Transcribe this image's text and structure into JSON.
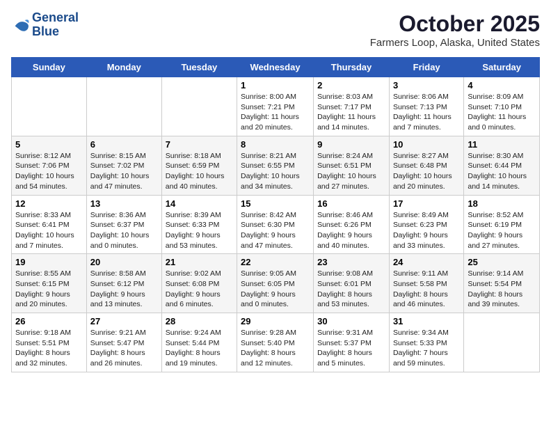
{
  "header": {
    "logo_line1": "General",
    "logo_line2": "Blue",
    "title": "October 2025",
    "subtitle": "Farmers Loop, Alaska, United States"
  },
  "days_of_week": [
    "Sunday",
    "Monday",
    "Tuesday",
    "Wednesday",
    "Thursday",
    "Friday",
    "Saturday"
  ],
  "weeks": [
    [
      {
        "date": "",
        "info": ""
      },
      {
        "date": "",
        "info": ""
      },
      {
        "date": "",
        "info": ""
      },
      {
        "date": "1",
        "info": "Sunrise: 8:00 AM\nSunset: 7:21 PM\nDaylight: 11 hours\nand 20 minutes."
      },
      {
        "date": "2",
        "info": "Sunrise: 8:03 AM\nSunset: 7:17 PM\nDaylight: 11 hours\nand 14 minutes."
      },
      {
        "date": "3",
        "info": "Sunrise: 8:06 AM\nSunset: 7:13 PM\nDaylight: 11 hours\nand 7 minutes."
      },
      {
        "date": "4",
        "info": "Sunrise: 8:09 AM\nSunset: 7:10 PM\nDaylight: 11 hours\nand 0 minutes."
      }
    ],
    [
      {
        "date": "5",
        "info": "Sunrise: 8:12 AM\nSunset: 7:06 PM\nDaylight: 10 hours\nand 54 minutes."
      },
      {
        "date": "6",
        "info": "Sunrise: 8:15 AM\nSunset: 7:02 PM\nDaylight: 10 hours\nand 47 minutes."
      },
      {
        "date": "7",
        "info": "Sunrise: 8:18 AM\nSunset: 6:59 PM\nDaylight: 10 hours\nand 40 minutes."
      },
      {
        "date": "8",
        "info": "Sunrise: 8:21 AM\nSunset: 6:55 PM\nDaylight: 10 hours\nand 34 minutes."
      },
      {
        "date": "9",
        "info": "Sunrise: 8:24 AM\nSunset: 6:51 PM\nDaylight: 10 hours\nand 27 minutes."
      },
      {
        "date": "10",
        "info": "Sunrise: 8:27 AM\nSunset: 6:48 PM\nDaylight: 10 hours\nand 20 minutes."
      },
      {
        "date": "11",
        "info": "Sunrise: 8:30 AM\nSunset: 6:44 PM\nDaylight: 10 hours\nand 14 minutes."
      }
    ],
    [
      {
        "date": "12",
        "info": "Sunrise: 8:33 AM\nSunset: 6:41 PM\nDaylight: 10 hours\nand 7 minutes."
      },
      {
        "date": "13",
        "info": "Sunrise: 8:36 AM\nSunset: 6:37 PM\nDaylight: 10 hours\nand 0 minutes."
      },
      {
        "date": "14",
        "info": "Sunrise: 8:39 AM\nSunset: 6:33 PM\nDaylight: 9 hours\nand 53 minutes."
      },
      {
        "date": "15",
        "info": "Sunrise: 8:42 AM\nSunset: 6:30 PM\nDaylight: 9 hours\nand 47 minutes."
      },
      {
        "date": "16",
        "info": "Sunrise: 8:46 AM\nSunset: 6:26 PM\nDaylight: 9 hours\nand 40 minutes."
      },
      {
        "date": "17",
        "info": "Sunrise: 8:49 AM\nSunset: 6:23 PM\nDaylight: 9 hours\nand 33 minutes."
      },
      {
        "date": "18",
        "info": "Sunrise: 8:52 AM\nSunset: 6:19 PM\nDaylight: 9 hours\nand 27 minutes."
      }
    ],
    [
      {
        "date": "19",
        "info": "Sunrise: 8:55 AM\nSunset: 6:15 PM\nDaylight: 9 hours\nand 20 minutes."
      },
      {
        "date": "20",
        "info": "Sunrise: 8:58 AM\nSunset: 6:12 PM\nDaylight: 9 hours\nand 13 minutes."
      },
      {
        "date": "21",
        "info": "Sunrise: 9:02 AM\nSunset: 6:08 PM\nDaylight: 9 hours\nand 6 minutes."
      },
      {
        "date": "22",
        "info": "Sunrise: 9:05 AM\nSunset: 6:05 PM\nDaylight: 9 hours\nand 0 minutes."
      },
      {
        "date": "23",
        "info": "Sunrise: 9:08 AM\nSunset: 6:01 PM\nDaylight: 8 hours\nand 53 minutes."
      },
      {
        "date": "24",
        "info": "Sunrise: 9:11 AM\nSunset: 5:58 PM\nDaylight: 8 hours\nand 46 minutes."
      },
      {
        "date": "25",
        "info": "Sunrise: 9:14 AM\nSunset: 5:54 PM\nDaylight: 8 hours\nand 39 minutes."
      }
    ],
    [
      {
        "date": "26",
        "info": "Sunrise: 9:18 AM\nSunset: 5:51 PM\nDaylight: 8 hours\nand 32 minutes."
      },
      {
        "date": "27",
        "info": "Sunrise: 9:21 AM\nSunset: 5:47 PM\nDaylight: 8 hours\nand 26 minutes."
      },
      {
        "date": "28",
        "info": "Sunrise: 9:24 AM\nSunset: 5:44 PM\nDaylight: 8 hours\nand 19 minutes."
      },
      {
        "date": "29",
        "info": "Sunrise: 9:28 AM\nSunset: 5:40 PM\nDaylight: 8 hours\nand 12 minutes."
      },
      {
        "date": "30",
        "info": "Sunrise: 9:31 AM\nSunset: 5:37 PM\nDaylight: 8 hours\nand 5 minutes."
      },
      {
        "date": "31",
        "info": "Sunrise: 9:34 AM\nSunset: 5:33 PM\nDaylight: 7 hours\nand 59 minutes."
      },
      {
        "date": "",
        "info": ""
      }
    ]
  ]
}
